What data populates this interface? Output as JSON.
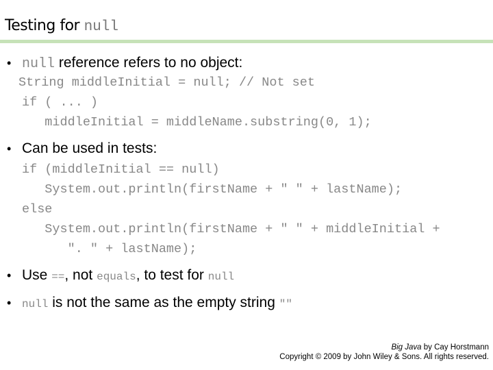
{
  "slide": {
    "title_text": "Testing for",
    "title_code": "null",
    "accent_color": "#c6e2b8",
    "bullets": [
      {
        "code_prefix": "null",
        "text": " reference refers to no object:"
      },
      {
        "text": "Can be used in tests:"
      },
      {
        "pre": "Use ",
        "code1": "==",
        "mid": ", not ",
        "code2": "equals",
        "mid2": ", to test for ",
        "code3": "null"
      },
      {
        "code_prefix": "null",
        "text": " is not the same as the empty string ",
        "code_suffix": "\"\""
      }
    ],
    "code_block_1": [
      "String middleInitial = null; // Not set",
      "if ( ... )",
      "   middleInitial = middleName.substring(0, 1);"
    ],
    "code_block_2": [
      "if (middleInitial == null)",
      "   System.out.println(firstName + \" \" + lastName);",
      "else",
      "   System.out.println(firstName + \" \" + middleInitial +",
      "      \". \" + lastName);"
    ]
  },
  "footer": {
    "book_title": "Big Java",
    "book_by": " by Cay Horstmann",
    "copyright": "Copyright © 2009 by John Wiley & Sons.  All rights reserved."
  }
}
